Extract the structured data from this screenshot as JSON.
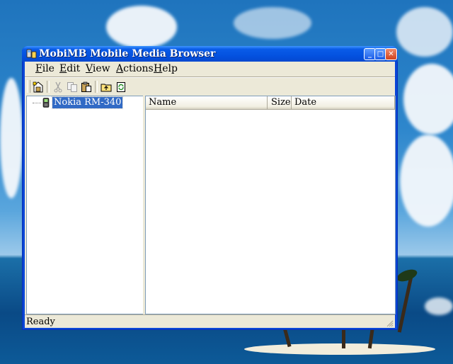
{
  "window": {
    "title": "MobiMB Mobile Media Browser",
    "accent": "#0a46d8"
  },
  "caption_buttons": [
    {
      "name": "minimize",
      "glyph": "_"
    },
    {
      "name": "maximize",
      "glyph": "□"
    },
    {
      "name": "close",
      "glyph": "✕"
    }
  ],
  "menu": {
    "items": [
      {
        "label_first": "F",
        "label_rest": "ile"
      },
      {
        "label_first": "E",
        "label_rest": "dit"
      },
      {
        "label_first": "V",
        "label_rest": "iew"
      },
      {
        "label_first": "A",
        "label_rest": "ctions"
      },
      {
        "label_first": "H",
        "label_rest": "elp"
      }
    ]
  },
  "toolbar": {
    "buttons": [
      {
        "icon": "properties-icon",
        "enabled": true
      },
      {
        "icon": "cut-icon",
        "enabled": false
      },
      {
        "icon": "copy-icon",
        "enabled": false
      },
      {
        "icon": "paste-icon",
        "enabled": true
      },
      {
        "icon": "up-folder-icon",
        "enabled": true
      },
      {
        "icon": "refresh-icon",
        "enabled": true
      }
    ]
  },
  "tree": {
    "nodes": [
      {
        "label": "Nokia RM-340",
        "icon": "phone-icon",
        "selected": true
      }
    ]
  },
  "list": {
    "columns": [
      "Name",
      "Size",
      "Date"
    ],
    "rows": []
  },
  "status": {
    "text": "Ready"
  }
}
